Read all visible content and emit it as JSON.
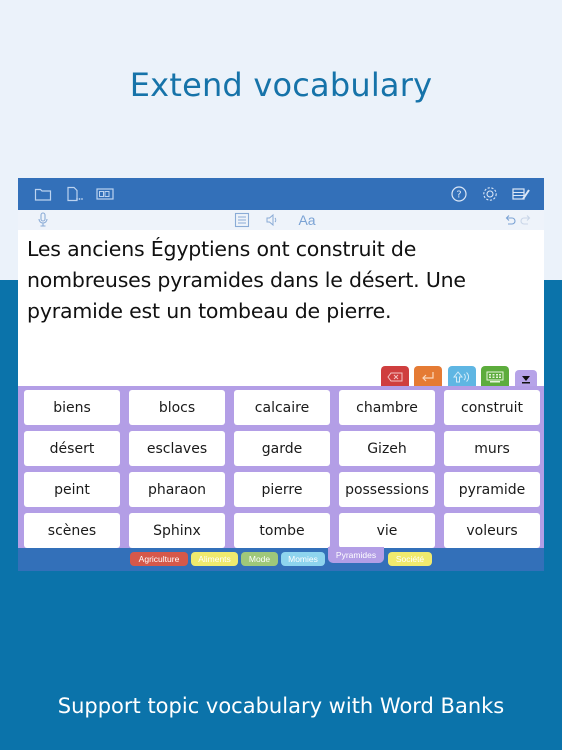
{
  "headline": "Extend vocabulary",
  "footer_caption": "Support topic vocabulary with Word Banks",
  "toolbar": {
    "left_icons": [
      "folder-icon",
      "new-document-icon",
      "word-bank-icon"
    ],
    "right_icons": [
      "help-icon",
      "settings-icon",
      "edit-list-icon"
    ]
  },
  "subbar": {
    "left_icons": [
      "microphone-icon"
    ],
    "center_icons": [
      "list-icon",
      "speaker-icon"
    ],
    "font_button_label": "Aa",
    "right_icons": [
      "undo-icon",
      "redo-icon"
    ]
  },
  "document": {
    "text": "Les anciens Égyptiens ont construit de nombreuses pyramides dans le désert. Une pyramide est un tombeau de pierre."
  },
  "keys": [
    {
      "name": "delete-key",
      "icon": "backspace-icon"
    },
    {
      "name": "return-key",
      "icon": "return-icon"
    },
    {
      "name": "shift-key",
      "icon": "shift-icon"
    },
    {
      "name": "keyboard-key",
      "icon": "keyboard-icon"
    },
    {
      "name": "hide-key",
      "icon": "collapse-icon"
    }
  ],
  "word_bank": {
    "words": [
      "biens",
      "blocs",
      "calcaire",
      "chambre",
      "construit",
      "désert",
      "esclaves",
      "garde",
      "Gizeh",
      "murs",
      "peint",
      "pharaon",
      "pierre",
      "possessions",
      "pyramide",
      "scènes",
      "Sphinx",
      "tombe",
      "vie",
      "voleurs"
    ]
  },
  "categories": [
    {
      "label": "Agriculture",
      "color": "#d5584a",
      "active": false
    },
    {
      "label": "Aliments",
      "color": "#f0ea6e",
      "active": false
    },
    {
      "label": "Mode",
      "color": "#9fc87a",
      "active": false
    },
    {
      "label": "Momies",
      "color": "#8ed4ee",
      "active": false
    },
    {
      "label": "Pyramides",
      "color": "#b39ee6",
      "active": true
    },
    {
      "label": "Société",
      "color": "#f0ea6e",
      "active": false
    }
  ],
  "colors": {
    "toolbar": "#3370b9",
    "headline": "#1673a9",
    "background_bottom": "#0b73aa",
    "word_bank": "#b39ee6"
  }
}
